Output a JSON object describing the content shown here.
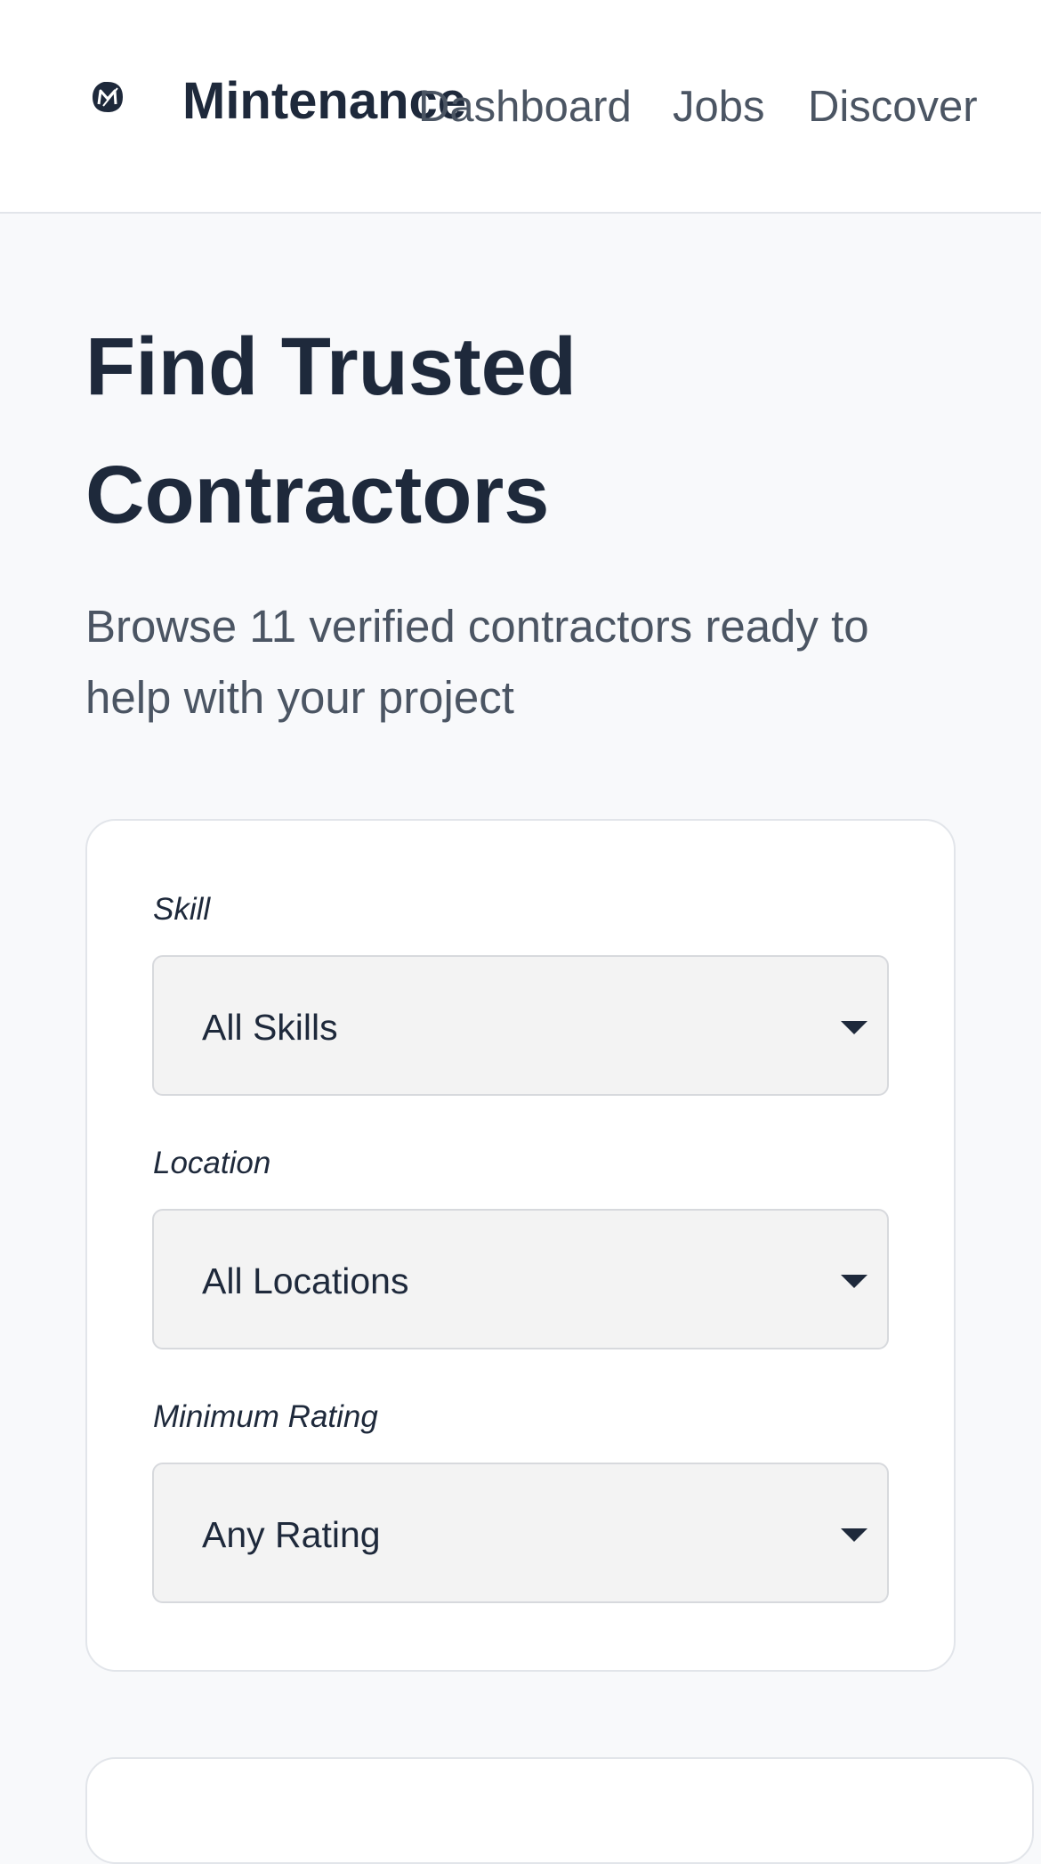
{
  "header": {
    "brand": "Mintenance",
    "logo_icon": "leaf-m-icon",
    "nav": [
      {
        "label": "Dashboard"
      },
      {
        "label": "Jobs"
      },
      {
        "label": "Discover"
      }
    ]
  },
  "hero": {
    "title": "Find Trusted Contractors",
    "subtitle": "Browse 11 verified contractors ready to help with your project"
  },
  "filters": {
    "skill": {
      "label": "Skill",
      "value": "All Skills"
    },
    "location": {
      "label": "Location",
      "value": "All Locations"
    },
    "rating": {
      "label": "Minimum Rating",
      "value": "Any Rating"
    }
  },
  "colors": {
    "text_primary": "#1e293b",
    "text_secondary": "#4b5563",
    "page_background": "#f8f9fb",
    "select_background": "#f3f3f3"
  }
}
